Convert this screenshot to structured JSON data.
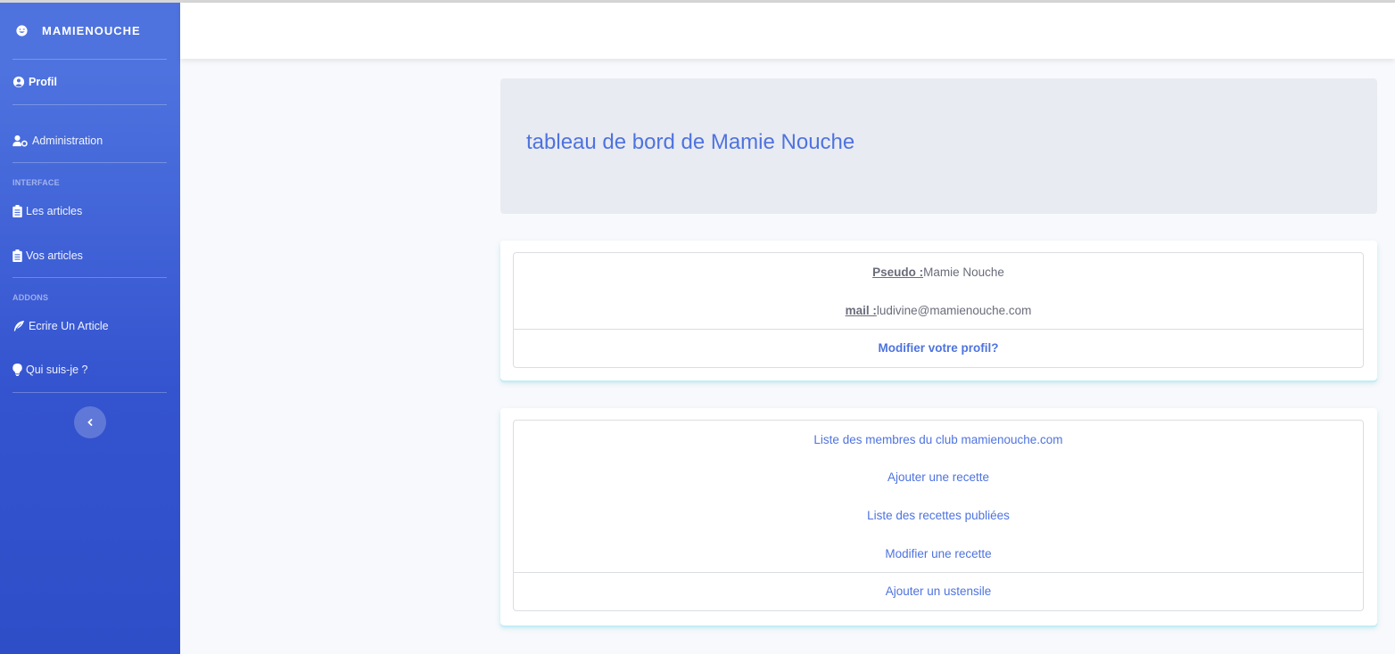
{
  "sidebar": {
    "brand": "MAMIENOUCHE",
    "items": [
      {
        "label": "Profil",
        "icon": "user-circle-icon"
      },
      {
        "label": "Administration",
        "icon": "user-cog-icon"
      },
      {
        "label": "Les articles",
        "icon": "clipboard-list-icon"
      },
      {
        "label": "Vos articles",
        "icon": "clipboard-list-icon"
      },
      {
        "label": "Ecrire Un Article",
        "icon": "feather-icon"
      },
      {
        "label": "Qui suis-je ?",
        "icon": "lightbulb-icon"
      }
    ],
    "headings": {
      "interface": "INTERFACE",
      "addons": "ADDONS"
    },
    "toggle_icon": "chevron-left-icon"
  },
  "dashboard": {
    "title": "tableau de bord de Mamie Nouche"
  },
  "profile": {
    "pseudo_label": "Pseudo :",
    "pseudo_value": "Mamie Nouche",
    "mail_label": "mail :",
    "mail_value": "ludivine@mamienouche.com",
    "edit_link": "Modifier votre profil?"
  },
  "actions": {
    "links": [
      "Liste des membres du club mamienouche.com",
      "Ajouter une recette",
      "Liste des recettes publiées",
      "Modifier une recette"
    ],
    "footer_link": "Ajouter un ustensile"
  },
  "colors": {
    "primary": "#4e73df",
    "sidebar_bottom": "#2e4ec8",
    "jumbotron_bg": "#e9ebf2",
    "card_accent": "#c2ecf6"
  }
}
